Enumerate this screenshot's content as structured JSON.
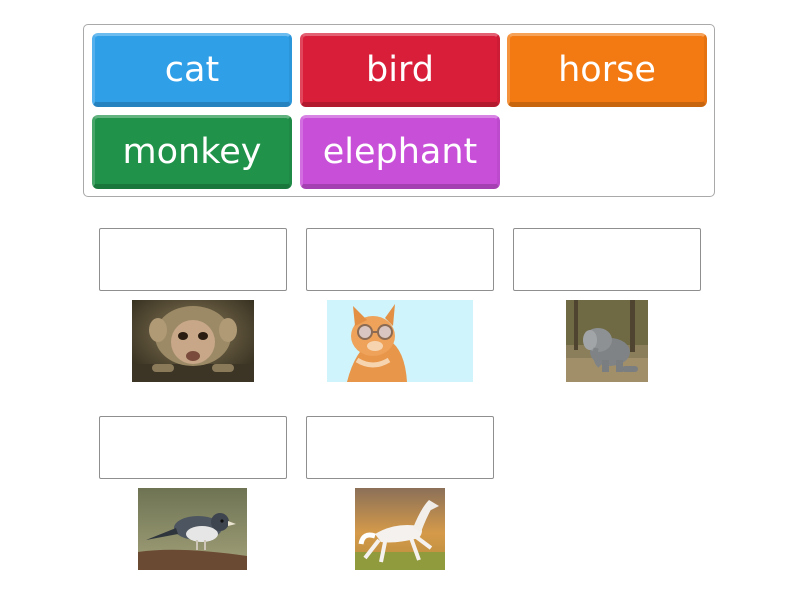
{
  "word_bank": {
    "tiles": [
      {
        "label": "cat",
        "color": "#2f9fe8"
      },
      {
        "label": "bird",
        "color": "#d91e39"
      },
      {
        "label": "horse",
        "color": "#f37a12"
      },
      {
        "label": "monkey",
        "color": "#20924a"
      },
      {
        "label": "elephant",
        "color": "#c84fd8"
      }
    ]
  },
  "drop_zones": [
    {
      "answer": "",
      "image": "monkey-photo"
    },
    {
      "answer": "",
      "image": "cat-photo"
    },
    {
      "answer": "",
      "image": "elephant-photo"
    },
    {
      "answer": "",
      "image": "bird-photo"
    },
    {
      "answer": "",
      "image": "horse-photo"
    }
  ]
}
